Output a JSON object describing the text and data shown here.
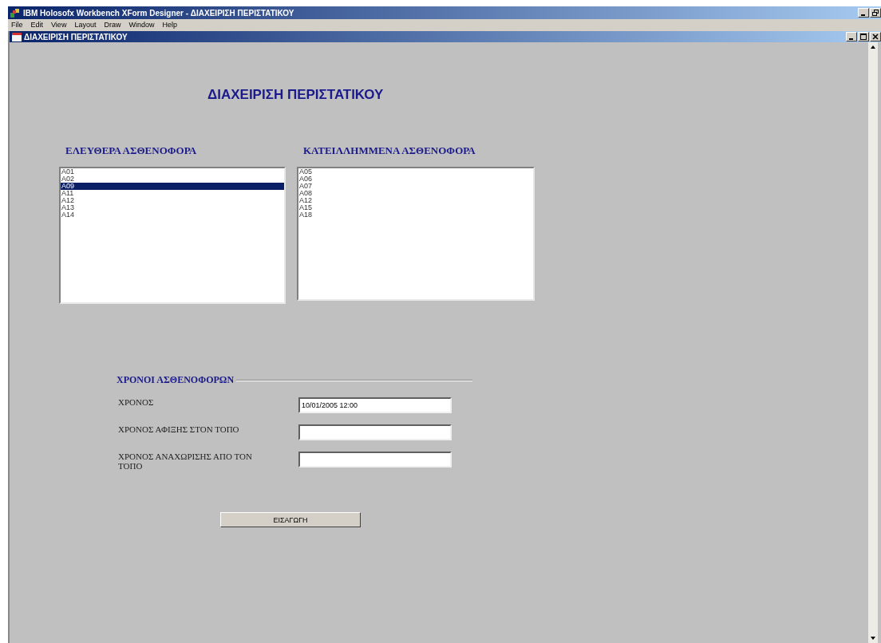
{
  "window": {
    "title": "IBM Holosofx Workbench XForm Designer - ΔΙΑΧΕΙΡΙΣΗ ΠΕΡΙΣΤΑΤΙΚΟΥ"
  },
  "menu": [
    "File",
    "Edit",
    "View",
    "Layout",
    "Draw",
    "Window",
    "Help"
  ],
  "document_window": {
    "title": "ΔΙΑΧΕΙΡΙΣΗ ΠΕΡΙΣΤΑΤΙΚΟΥ"
  },
  "form": {
    "heading": "ΔΙΑΧΕΙΡΙΣΗ ΠΕΡΙΣΤΑΤΙΚΟΥ",
    "lists": [
      {
        "label": "ΕΛΕΥΘΕΡΑ ΑΣΘΕΝΟΦΟΡΑ",
        "items": [
          {
            "text": "A01",
            "selected": false
          },
          {
            "text": "A02",
            "selected": false
          },
          {
            "text": "A09",
            "selected": true
          },
          {
            "text": "A11",
            "selected": false
          },
          {
            "text": "A12",
            "selected": false
          },
          {
            "text": "A13",
            "selected": false
          },
          {
            "text": "A14",
            "selected": false
          }
        ]
      },
      {
        "label": "ΚΑΤΕΙΛΛΗΜΜΕΝΑ ΑΣΘΕΝΟΦΟΡΑ",
        "items": [
          {
            "text": "A05",
            "selected": false
          },
          {
            "text": "A06",
            "selected": false
          },
          {
            "text": "A07",
            "selected": false
          },
          {
            "text": "A08",
            "selected": false
          },
          {
            "text": "A12",
            "selected": false
          },
          {
            "text": "A15",
            "selected": false
          },
          {
            "text": "A18",
            "selected": false
          }
        ]
      }
    ],
    "group": {
      "title": "ΧΡΟΝΟΙ ΑΣΘΕΝΟΦΟΡΩΝ",
      "fields": [
        {
          "label": "ΧΡΟΝΟΣ",
          "value": "10/01/2005 12:00"
        },
        {
          "label": "ΧΡΟΝΟΣ ΑΦΙΞΗΣ ΣΤΟΝ ΤΟΠΟ"
        },
        {
          "label": "ΧΡΟΝΟΣ ΑΝΑΧΩΡΙΣΗΣ ΑΠΟ ΤΟΝ ΤΟΠΟ"
        }
      ]
    },
    "button": "ΕΙΣΑΓΩΓΗ"
  }
}
